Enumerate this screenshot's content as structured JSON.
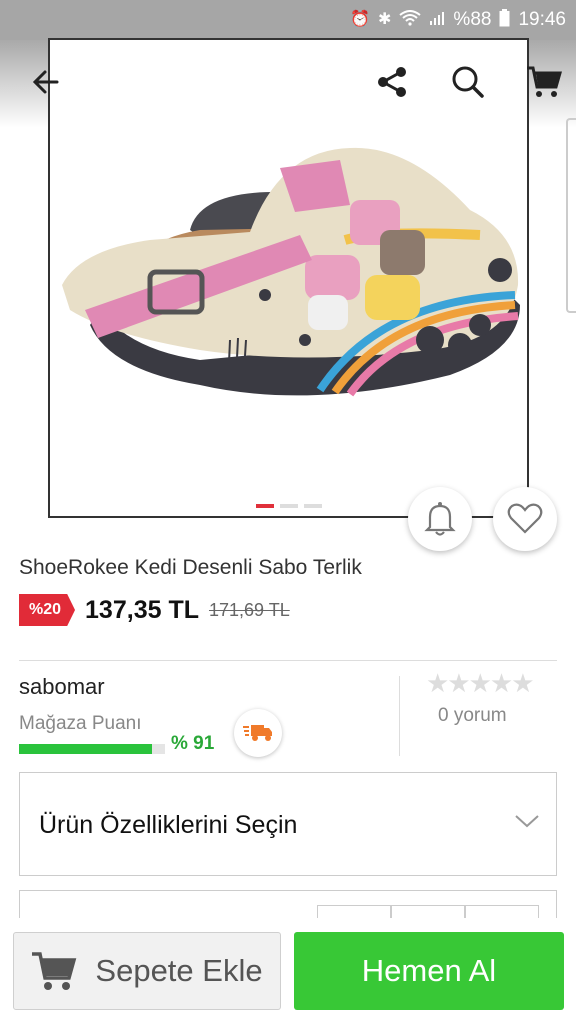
{
  "status_bar": {
    "battery_text": "%88",
    "time": "19:46",
    "icons": [
      "alarm-icon",
      "bluetooth-icon",
      "wifi-icon",
      "signal-icon",
      "battery-icon"
    ]
  },
  "app_bar": {
    "icons": [
      "back-arrow-icon",
      "share-icon",
      "search-icon",
      "cart-icon"
    ]
  },
  "gallery": {
    "image_count": 3,
    "active_index": 0,
    "active_color": "#e0303a"
  },
  "product": {
    "title": "ShoeRokee Kedi Desenli Sabo Terlik",
    "discount_badge": "%20",
    "price": "137,35 TL",
    "old_price": "171,69 TL"
  },
  "seller": {
    "name": "sabomar",
    "score_label": "Mağaza Puanı",
    "score_value": "% 91",
    "score_fraction": 0.91,
    "shipping_icon": "fast-shipping-truck-icon"
  },
  "reviews": {
    "stars": "★★★★★",
    "rating": 0,
    "count_text": "0 yorum"
  },
  "options": {
    "select_label": "Ürün Özelliklerini Seçin"
  },
  "actions": {
    "add_to_cart_label": "Sepete Ekle",
    "buy_now_label": "Hemen Al"
  },
  "colors": {
    "discount_red": "#e12b38",
    "buy_green": "#38c836",
    "score_green": "#2ac33c"
  }
}
